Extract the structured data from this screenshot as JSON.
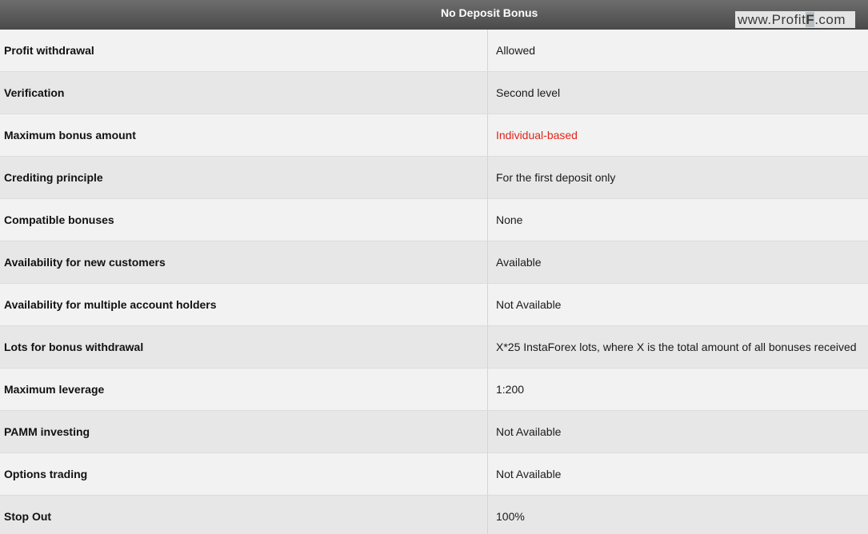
{
  "header": {
    "title": "No Deposit Bonus",
    "watermark_pre": "www.Profit",
    "watermark_f": "F",
    "watermark_post": ".com"
  },
  "colors": {
    "highlight": "#e0261b",
    "header_bg": "#555555"
  },
  "rows": [
    {
      "label": "Profit withdrawal",
      "value": "Allowed"
    },
    {
      "label": "Verification",
      "value": "Second level"
    },
    {
      "label": "Maximum bonus amount",
      "value": "Individual-based"
    },
    {
      "label": "Crediting principle",
      "value": "For the first deposit only"
    },
    {
      "label": "Compatible bonuses",
      "value": "None"
    },
    {
      "label": "Availability for new customers",
      "value": "Available"
    },
    {
      "label": "Availability for multiple account holders",
      "value": "Not Available"
    },
    {
      "label": "Lots for bonus withdrawal",
      "value": "X*25 InstaForex lots, where X is the total amount of all bonuses received"
    },
    {
      "label": "Maximum leverage",
      "value": "1:200"
    },
    {
      "label": "PAMM investing",
      "value": "Not Available"
    },
    {
      "label": "Options trading",
      "value": "Not Available"
    },
    {
      "label": "Stop Out",
      "value": "100%"
    }
  ]
}
